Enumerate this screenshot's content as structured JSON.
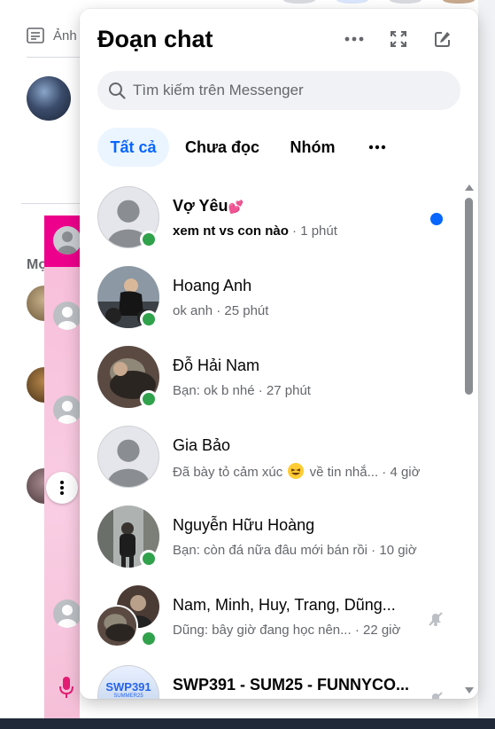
{
  "background": {
    "post_label": "Ảnh",
    "section_label": "Mọ"
  },
  "panel": {
    "title": "Đoạn chat",
    "options_icon": "more-horizontal-icon",
    "expand_icon": "expand-icon",
    "compose_icon": "compose-icon"
  },
  "search": {
    "placeholder": "Tìm kiếm trên Messenger"
  },
  "tabs": [
    {
      "label": "Tất cả",
      "active": true
    },
    {
      "label": "Chưa đọc",
      "active": false
    },
    {
      "label": "Nhóm",
      "active": false
    },
    {
      "label": "•••",
      "active": false
    }
  ],
  "conversations": [
    {
      "name": "Vợ Yêu",
      "name_suffix": "💕",
      "snippet": "xem nt vs con nào",
      "time": " · 1 phút",
      "online": true,
      "unread": true,
      "muted": false
    },
    {
      "name": "Hoang Anh",
      "snippet": "ok anh",
      "time": " · 25 phút",
      "online": true,
      "unread": false,
      "muted": false
    },
    {
      "name": "Đỗ Hải Nam",
      "snippet": "Bạn: ok b nhé",
      "time": " · 27 phút",
      "online": true,
      "unread": false,
      "muted": false
    },
    {
      "name": "Gia Bảo",
      "snippet": "Đã bày tỏ cảm xúc",
      "snippet_after": "về tin nhắ...",
      "time": " · 4 giờ",
      "online": false,
      "unread": false,
      "muted": false
    },
    {
      "name": "Nguyễn Hữu Hoàng",
      "snippet": "Bạn: còn đá nữa đâu mới bán rồi",
      "time": " · 10 giờ",
      "online": true,
      "unread": false,
      "muted": false
    },
    {
      "name": "Nam, Minh, Huy, Trang, Dũng...",
      "snippet": "Dũng: bây giờ đang học nên...",
      "time": " · 22 giờ",
      "online": true,
      "unread": false,
      "muted": true
    },
    {
      "name": "SWP391 - SUM25 - FUNNYCO...",
      "avatar_text": "SWP391",
      "avatar_subtext": "SUMMER25",
      "snippet": "",
      "time": "",
      "online": false,
      "unread": false,
      "muted": true
    }
  ],
  "colors": {
    "accent": "#0866ff",
    "online": "#31a24c",
    "tab_active_bg": "#ebf5ff",
    "pink": "#ec008c"
  }
}
